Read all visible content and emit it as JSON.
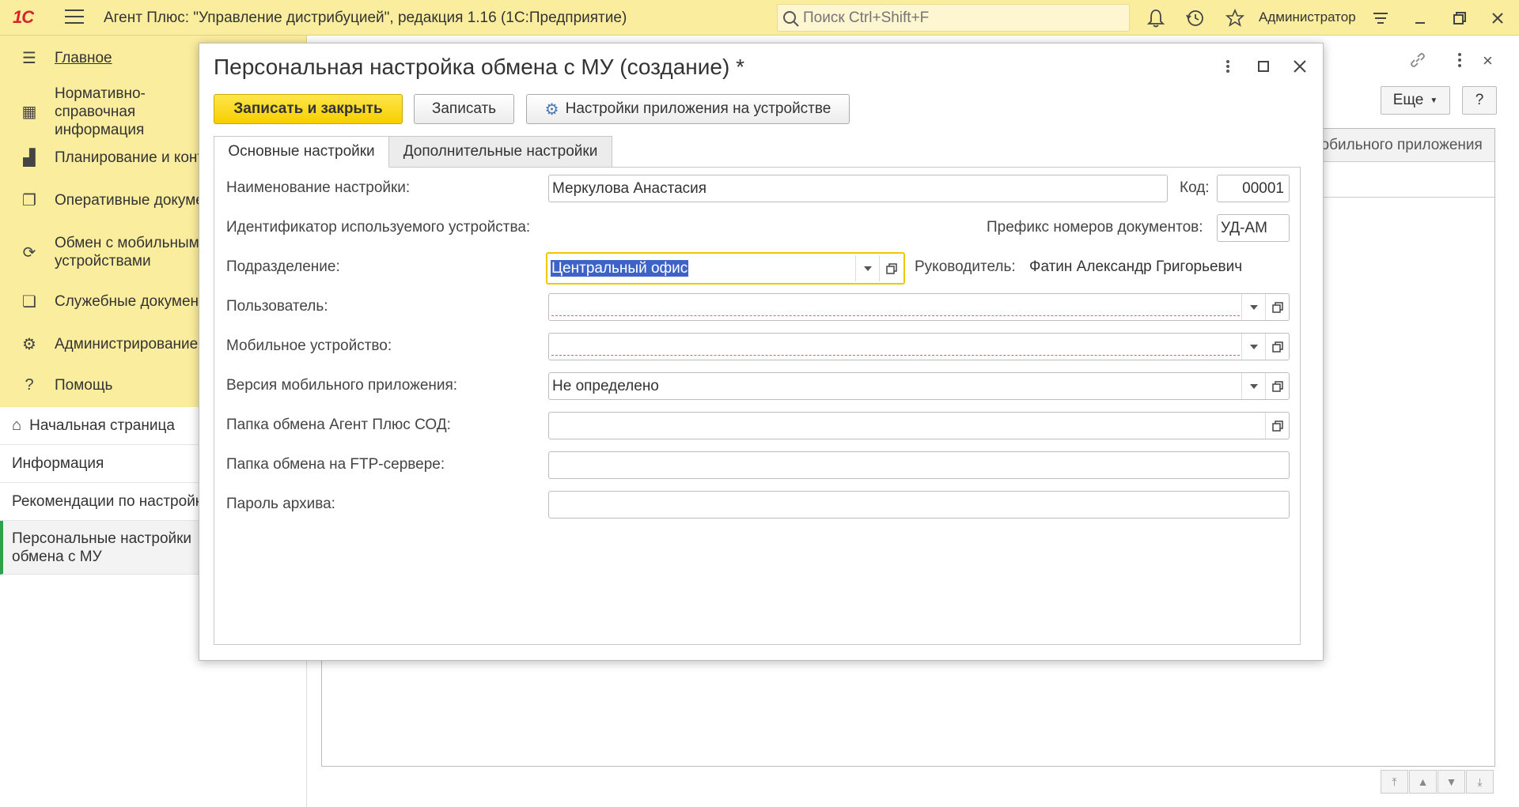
{
  "app": {
    "logo": "1С",
    "title": "Агент Плюс: \"Управление дистрибуцией\", редакция 1.16  (1С:Предприятие)",
    "search_placeholder": "Поиск Ctrl+Shift+F",
    "user": "Администратор"
  },
  "sidebar": {
    "items": [
      {
        "icon": "menu-lines-icon",
        "label": "Главное"
      },
      {
        "icon": "grid-icon",
        "label": "Нормативно-справочная информация"
      },
      {
        "icon": "bar-chart-icon",
        "label": "Планирование и контроль"
      },
      {
        "icon": "documents-icon",
        "label": "Оперативные документы"
      },
      {
        "icon": "sync-icon",
        "label": "Обмен с мобильными устройствами"
      },
      {
        "icon": "service-docs-icon",
        "label": "Служебные документы"
      },
      {
        "icon": "gear-icon",
        "label": "Администрирование"
      },
      {
        "icon": "help-icon",
        "label": "Помощь"
      }
    ]
  },
  "open_windows": {
    "items": [
      {
        "label": "Начальная страница"
      },
      {
        "label": "Информация"
      },
      {
        "label": "Рекомендации по настройке"
      },
      {
        "label": "Персональные настройки обмена с МУ"
      }
    ]
  },
  "background": {
    "more_button": "Еще",
    "help_button": "?",
    "column_header": "Версия мобильного приложения"
  },
  "dialog": {
    "title": "Персональная настройка обмена с МУ (создание) *",
    "buttons": {
      "save_close": "Записать и закрыть",
      "save": "Записать",
      "device_settings": "Настройки приложения на устройстве"
    },
    "tabs": [
      {
        "label": "Основные настройки",
        "active": true
      },
      {
        "label": "Дополнительные настройки",
        "active": false
      }
    ],
    "fields": {
      "name_label": "Наименование настройки:",
      "name_value": "Меркулова Анастасия",
      "code_label": "Код:",
      "code_value": "00001",
      "device_id_label": "Идентификатор используемого устройства:",
      "prefix_label": "Префикс номеров документов:",
      "prefix_value": "УД-АМ",
      "division_label": "Подразделение:",
      "division_value": "Центральный офис",
      "manager_label": "Руководитель:",
      "manager_value": "Фатин Александр Григорьевич",
      "user_label": "Пользователь:",
      "user_value": "",
      "device_label": "Мобильное устройство:",
      "device_value": "",
      "app_version_label": "Версия мобильного приложения:",
      "app_version_value": "Не определено",
      "exchange_folder_label": "Папка обмена Агент Плюс СОД:",
      "exchange_folder_value": "",
      "ftp_folder_label": "Папка обмена на FTP-сервере:",
      "ftp_folder_value": "",
      "archive_password_label": "Пароль архива:",
      "archive_password_value": ""
    }
  },
  "colors": {
    "panel_yellow": "#fbed9e",
    "primary_button": "#f6cf00",
    "active_marker": "#2ea24a",
    "selection": "#3d63c9"
  }
}
